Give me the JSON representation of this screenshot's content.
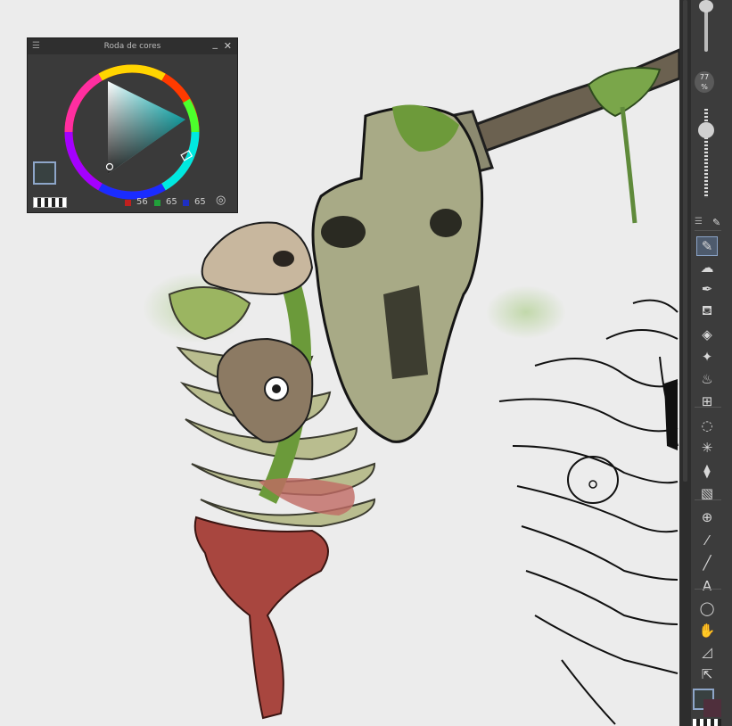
{
  "color_wheel": {
    "title": "Roda de cores",
    "menu_icon": "hamburger-icon",
    "minimize_icon": "minimize-icon",
    "close_icon": "close-icon",
    "rgb": {
      "r": "56",
      "g": "65",
      "b": "65"
    },
    "colors": {
      "foreground": "#384141",
      "background": "#4f2f3c",
      "r_dot": "#c0201e",
      "g_dot": "#21a03a",
      "b_dot": "#1e2fc2"
    }
  },
  "toolbar": {
    "size_value": "77",
    "size_unit": "%",
    "tools": [
      {
        "name": "brush-icon",
        "glyph": "✎",
        "active": true
      },
      {
        "name": "cloud-brush-icon",
        "glyph": "☁",
        "active": false
      },
      {
        "name": "pen-nib-icon",
        "glyph": "✒",
        "active": false
      },
      {
        "name": "airbrush-icon",
        "glyph": "⛾",
        "active": false
      },
      {
        "name": "eraser-icon",
        "glyph": "◈",
        "active": false
      },
      {
        "name": "sparkle-icon",
        "glyph": "✦",
        "active": false
      },
      {
        "name": "blend-drops-icon",
        "glyph": "♨",
        "active": false
      },
      {
        "name": "grid-transform-icon",
        "glyph": "⊞",
        "active": false
      },
      {
        "name": "lasso-select-icon",
        "glyph": "◌",
        "active": false
      },
      {
        "name": "magic-wand-icon",
        "glyph": "✳",
        "active": false
      },
      {
        "name": "fill-bucket-icon",
        "glyph": "⧫",
        "active": false
      },
      {
        "name": "gradient-icon",
        "glyph": "▧",
        "active": false
      },
      {
        "name": "move-layer-icon",
        "glyph": "⊕",
        "active": false
      },
      {
        "name": "eyedropper-icon",
        "glyph": "⁄",
        "active": false
      },
      {
        "name": "line-icon",
        "glyph": "╱",
        "active": false
      },
      {
        "name": "text-icon",
        "glyph": "A",
        "active": false
      },
      {
        "name": "speech-bubble-icon",
        "glyph": "◯",
        "active": false
      },
      {
        "name": "hand-pan-icon",
        "glyph": "✋",
        "active": false
      },
      {
        "name": "ruler-triangle-icon",
        "glyph": "◿",
        "active": false
      },
      {
        "name": "select-arrow-icon",
        "glyph": "⇱",
        "active": false
      }
    ]
  }
}
